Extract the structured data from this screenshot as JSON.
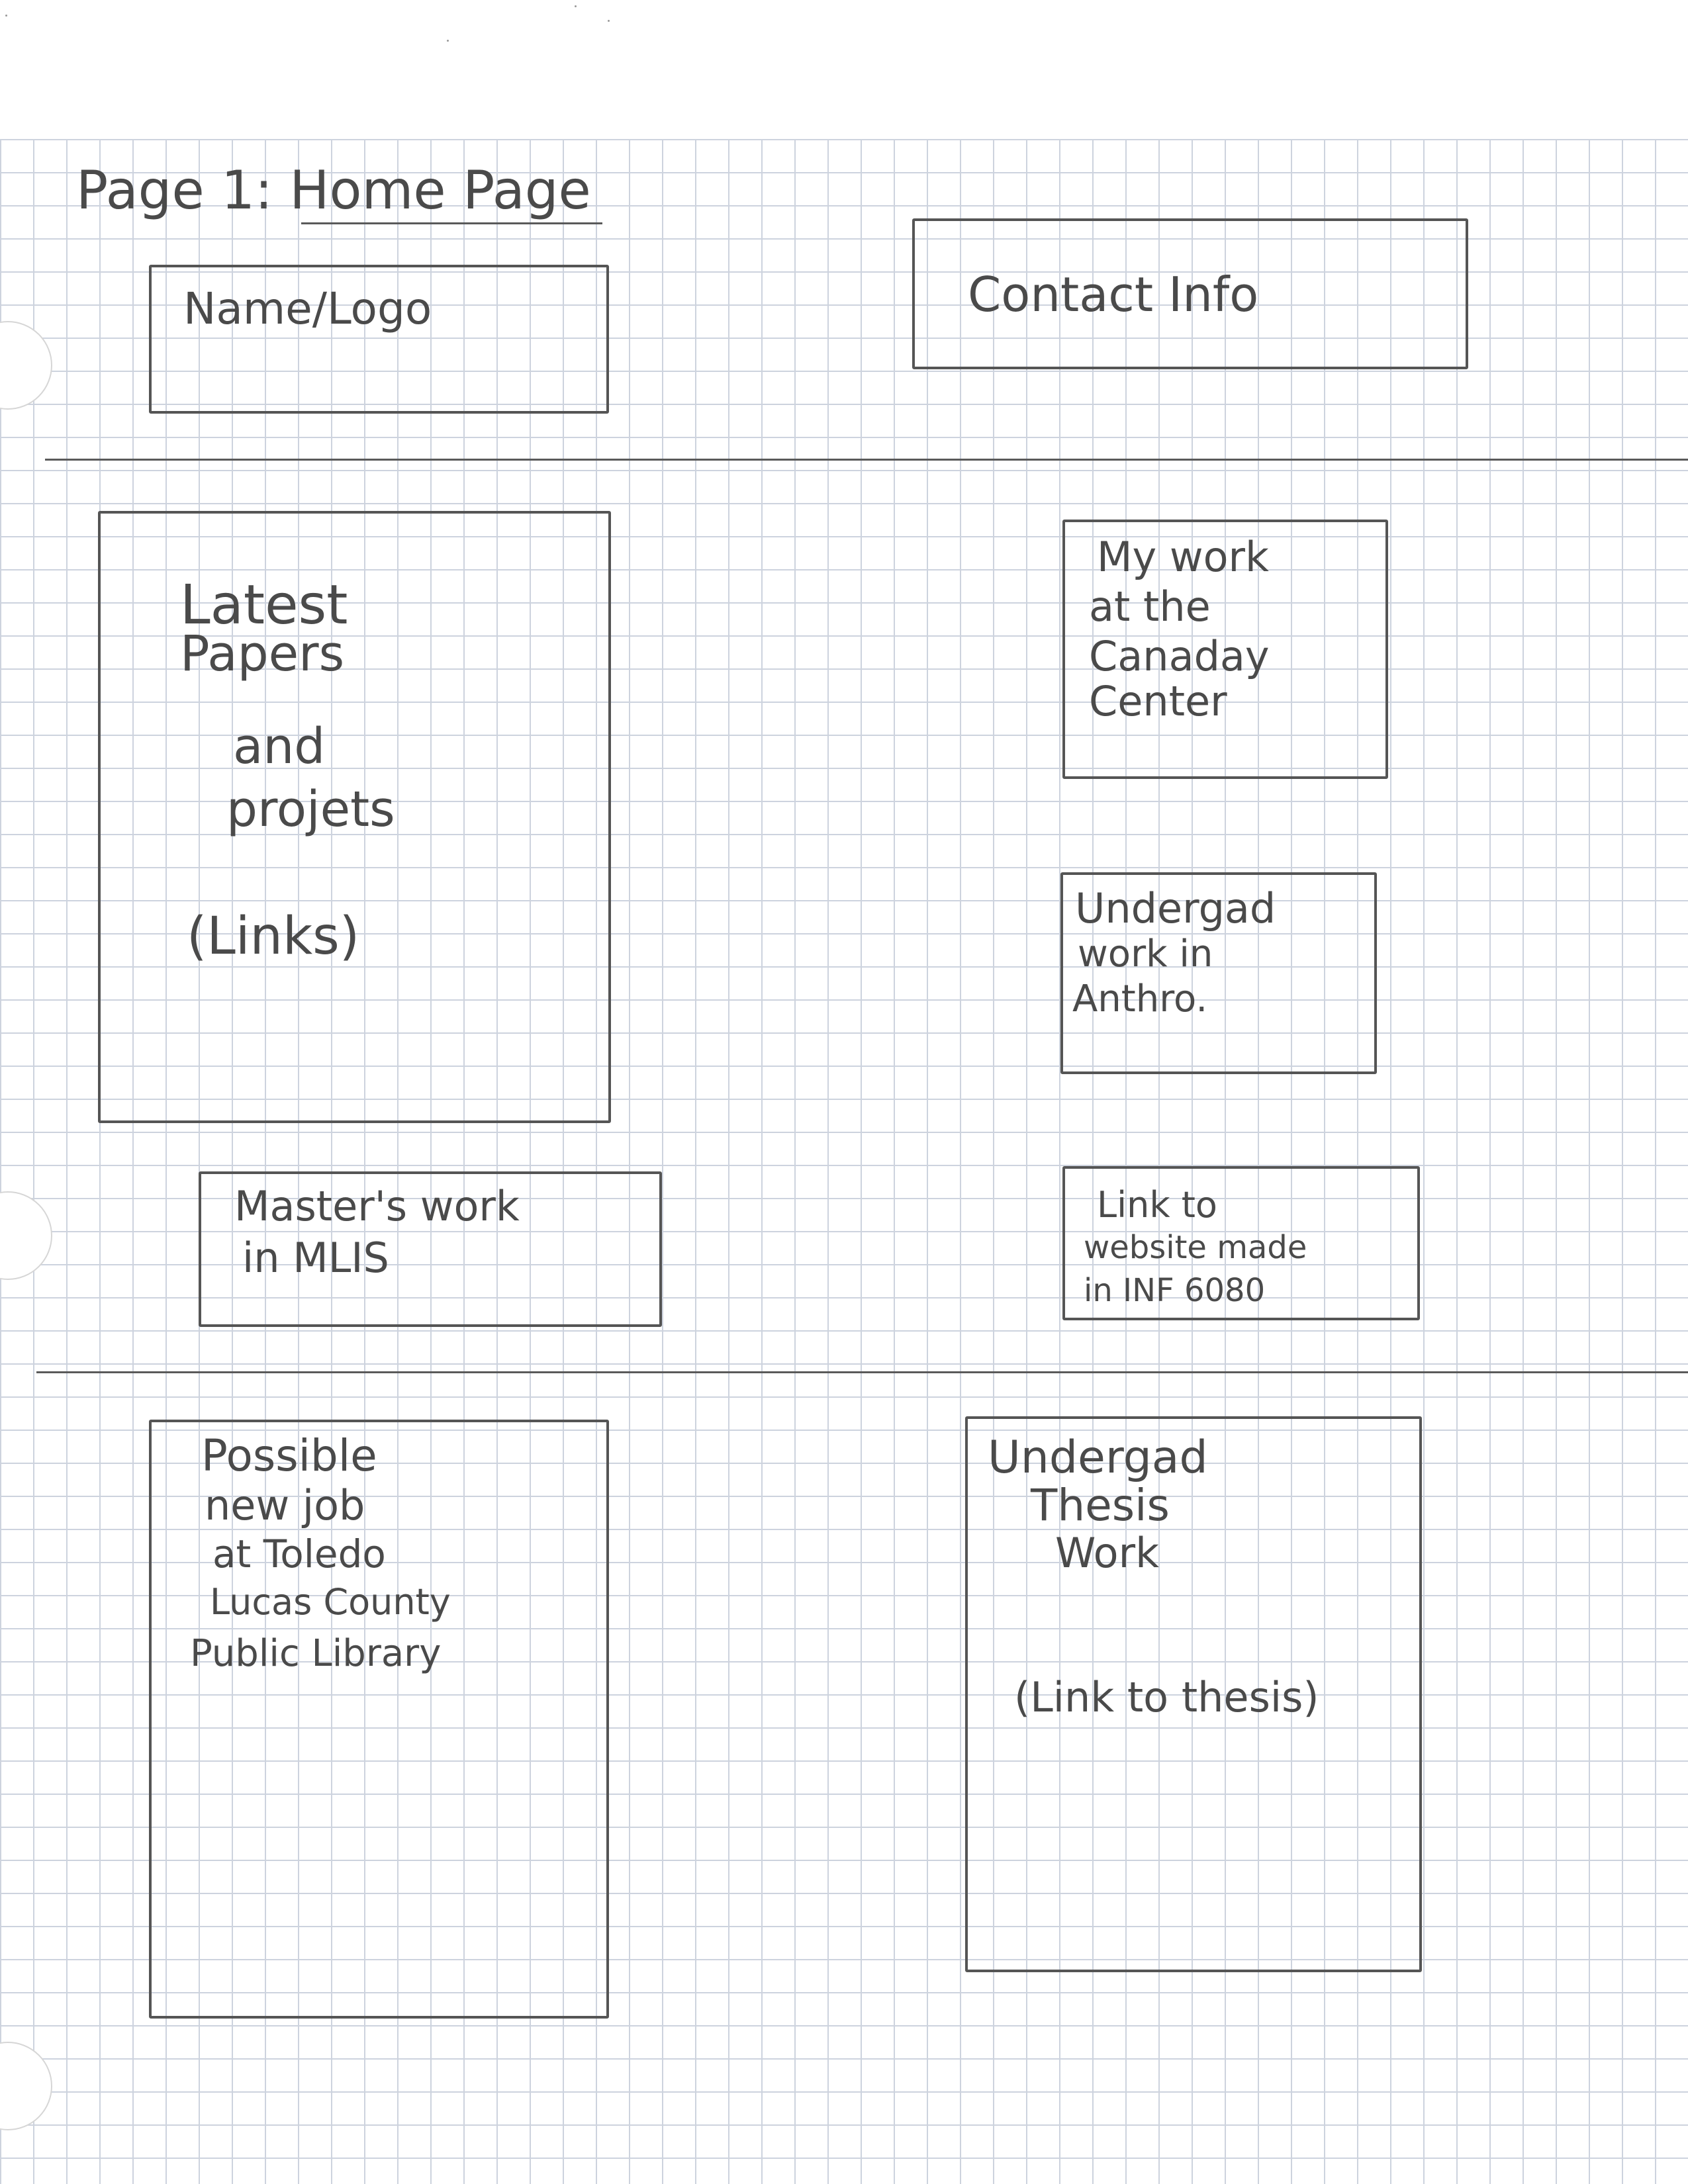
{
  "page_title": "Page 1: Home Page",
  "boxes": {
    "name_logo": {
      "label": "Name/Logo"
    },
    "contact_info": {
      "label": "Contact Info"
    },
    "latest_papers": {
      "line1": "Latest",
      "line2": "Papers",
      "line3": "and",
      "line4": "projets",
      "line5": "(Links)"
    },
    "canaday": {
      "line1": "My work",
      "line2": "at the",
      "line3": "Canaday",
      "line4": "Center"
    },
    "undergrad_anthro": {
      "line1": "Undergad",
      "line2": "work in",
      "line3": "Anthro."
    },
    "masters_mlis": {
      "line1": "Master's work",
      "line2": "in MLIS"
    },
    "website_link": {
      "line1": "Link to",
      "line2": "website made",
      "line3": "in INF 6080"
    },
    "new_job": {
      "line1": "Possible",
      "line2": "new job",
      "line3": "at Toledo",
      "line4": "Lucas County",
      "line5": "Public Library"
    },
    "thesis": {
      "line1": "Undergad",
      "line2": "Thesis",
      "line3": "Work",
      "line4": "(Link to thesis)"
    }
  }
}
